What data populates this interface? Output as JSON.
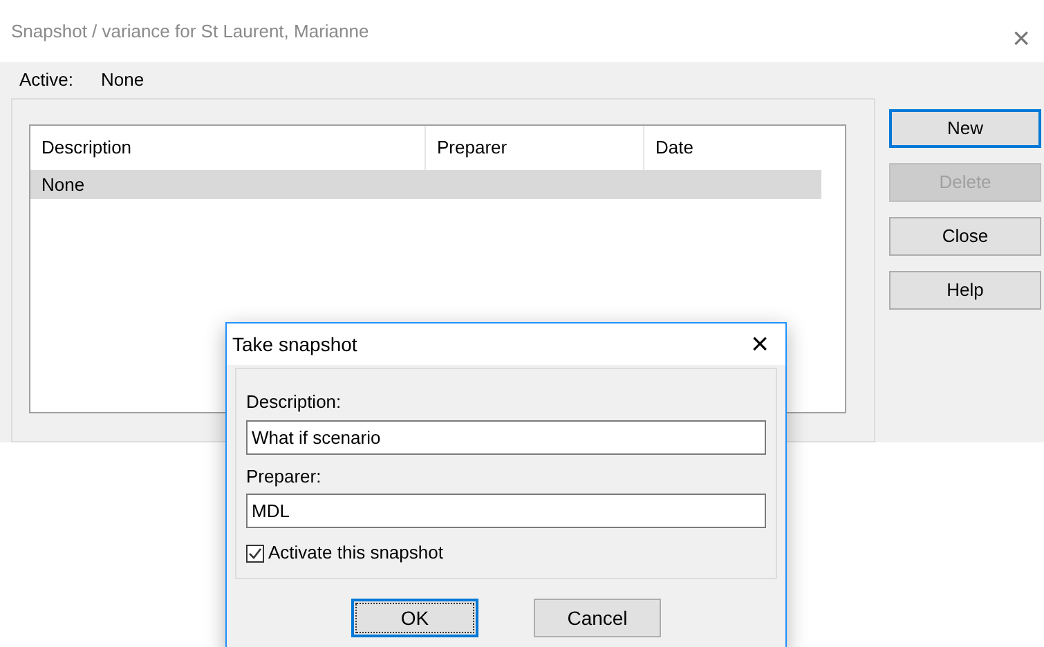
{
  "window": {
    "title": "Snapshot / variance for St Laurent, Marianne",
    "close": "×"
  },
  "active": {
    "label": "Active:",
    "value": "None"
  },
  "table": {
    "columns": [
      "Description",
      "Preparer",
      "Date"
    ],
    "rows": [
      {
        "cells": [
          "None",
          "",
          ""
        ],
        "selected": true
      }
    ]
  },
  "buttons": [
    {
      "label": "New",
      "focused": true,
      "disabled": false
    },
    {
      "label": "Delete",
      "focused": false,
      "disabled": true
    },
    {
      "label": "Close",
      "focused": false,
      "disabled": false
    },
    {
      "label": "Help",
      "focused": false,
      "disabled": false
    }
  ],
  "dialog": {
    "title": "Take snapshot",
    "close": "×",
    "fields": [
      {
        "label": "Description:",
        "value": "What if scenario"
      },
      {
        "label": "Preparer:",
        "value": "MDL"
      }
    ],
    "checkbox": {
      "label": "Activate this snapshot",
      "checked": true
    },
    "buttons": [
      {
        "label": "OK",
        "focused": true
      },
      {
        "label": "Cancel",
        "focused": false
      }
    ]
  }
}
